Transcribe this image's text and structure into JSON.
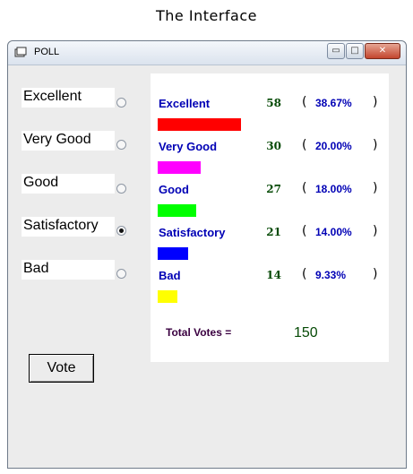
{
  "caption": "The Interface",
  "window": {
    "title": "POLL",
    "controls": {
      "minimize": "▭",
      "maximize": "□",
      "close": "✕"
    }
  },
  "options": [
    {
      "label": "Excellent",
      "checked": false
    },
    {
      "label": "Very Good",
      "checked": false
    },
    {
      "label": "Good",
      "checked": false
    },
    {
      "label": "Satisfactory",
      "checked": true
    },
    {
      "label": "Bad",
      "checked": false
    }
  ],
  "results": [
    {
      "name": "Excellent",
      "count": "58",
      "percent": "38.67%",
      "share": 0.3867,
      "color": "#ff0000"
    },
    {
      "name": "Very Good",
      "count": "30",
      "percent": "20.00%",
      "share": 0.2,
      "color": "#ff00ff"
    },
    {
      "name": "Good",
      "count": "27",
      "percent": "18.00%",
      "share": 0.18,
      "color": "#00ff00"
    },
    {
      "name": "Satisfactory",
      "count": "21",
      "percent": "14.00%",
      "share": 0.14,
      "color": "#0000ff"
    },
    {
      "name": "Bad",
      "count": "14",
      "percent": "9.33%",
      "share": 0.0933,
      "color": "#ffff00"
    }
  ],
  "paren_open": "(",
  "paren_close": ")",
  "total": {
    "label": "Total Votes =",
    "value": "150"
  },
  "vote_button": "Vote"
}
